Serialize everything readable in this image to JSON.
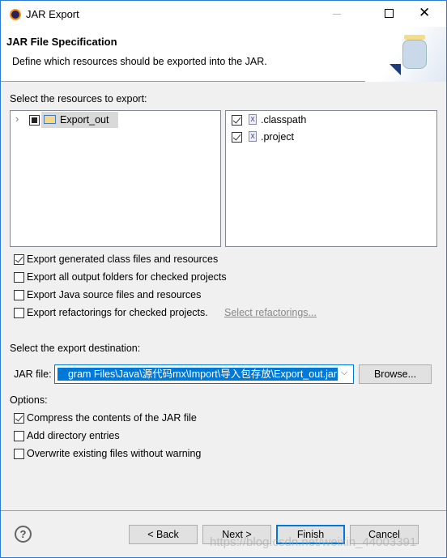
{
  "window": {
    "title": "JAR Export"
  },
  "header": {
    "title": "JAR File Specification",
    "description": "Define which resources should be exported into the JAR."
  },
  "resources": {
    "label": "Select the resources to export:",
    "tree": [
      {
        "label": "Export_out",
        "state": "partial"
      }
    ],
    "files": [
      {
        "label": ".classpath",
        "checked": true
      },
      {
        "label": ".project",
        "checked": true
      }
    ]
  },
  "export_options": [
    {
      "label": "Export generated class files and resources",
      "checked": true
    },
    {
      "label": "Export all output folders for checked projects",
      "checked": false
    },
    {
      "label": "Export Java source files and resources",
      "checked": false
    },
    {
      "label": "Export refactorings for checked projects.",
      "checked": false
    }
  ],
  "select_refactorings_link": "Select refactorings...",
  "destination": {
    "label": "Select the export destination:",
    "jar_label": "JAR file:",
    "jar_value": "gram Files\\Java\\源代码mx\\Import\\导入包存放\\Export_out.jar",
    "browse": "Browse..."
  },
  "options": {
    "label": "Options:",
    "items": [
      {
        "label": "Compress the contents of the JAR file",
        "checked": true
      },
      {
        "label": "Add directory entries",
        "checked": false
      },
      {
        "label": "Overwrite existing files without warning",
        "checked": false
      }
    ]
  },
  "buttons": {
    "back": "< Back",
    "next": "Next >",
    "finish": "Finish",
    "cancel": "Cancel"
  },
  "watermark": "https://blog.csdn.net/weixin_44003391",
  "colors": {
    "accent": "#0078d7",
    "selection": "#0078d7"
  }
}
